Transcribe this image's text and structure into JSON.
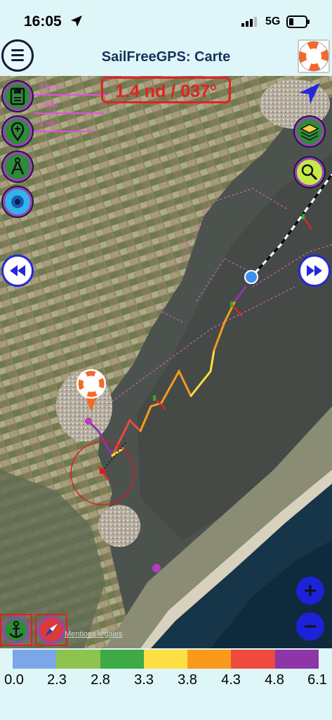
{
  "status": {
    "time": "16:05",
    "network": "5G"
  },
  "header": {
    "title": "SailFreeGPS: Carte"
  },
  "map": {
    "speed_heading": "1.4 nd / 037°",
    "scale": {
      "km": "2 Km",
      "nm": "1 NM",
      "mi": "1 mi"
    },
    "mentions_label": "Mentions légales"
  },
  "legend": {
    "colors": [
      "#7ba7e8",
      "#8dc44f",
      "#3daa46",
      "#fde043",
      "#fa9a1d",
      "#ee4a3e",
      "#8e35a8"
    ],
    "labels": [
      "0.0",
      "2.3",
      "2.8",
      "3.3",
      "3.8",
      "4.3",
      "4.8",
      "6.1"
    ]
  },
  "icons": {
    "left_column": [
      "save-icon",
      "add-location-icon",
      "compass-measure-icon",
      "eye-icon"
    ],
    "right_column": [
      "navigation-arrow-icon",
      "layers-icon",
      "search-icon"
    ],
    "replay": [
      "rewind-icon",
      "fast-forward-icon"
    ],
    "zoom": [
      "zoom-in-icon",
      "zoom-out-icon"
    ],
    "bottom": [
      "anchor-icon",
      "compass-icon"
    ]
  }
}
